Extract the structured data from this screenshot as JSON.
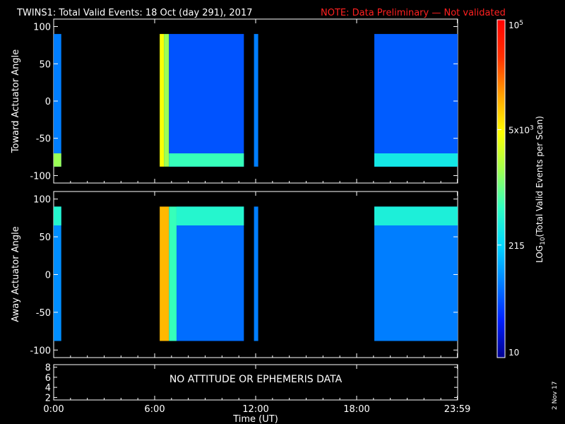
{
  "header": {
    "title": "TWINS1: Total Valid Events: 18 Oct (day 291), 2017",
    "note": "NOTE: Data Preliminary — Not validated",
    "note_color": "#ff2020"
  },
  "footer": {
    "date_stamp": "2 Nov 17",
    "no_data_message": "NO ATTITUDE OR EPHEMERIS DATA"
  },
  "chart_data": [
    {
      "type": "heatmap",
      "name": "toward",
      "ylabel": "Toward Actuator Angle",
      "ylim": [
        -110,
        110
      ],
      "yticks": [
        100,
        50,
        0,
        -50,
        -100
      ],
      "xlim_hours": [
        0,
        24
      ],
      "data_angle_range": [
        -88,
        90
      ],
      "blocks": [
        {
          "start_h": 0.0,
          "end_h": 0.45,
          "level": 0.22,
          "low_edge_level": 0.55
        },
        {
          "start_h": 6.3,
          "end_h": 6.55,
          "level": 0.66
        },
        {
          "start_h": 6.55,
          "end_h": 6.85,
          "level": 0.55
        },
        {
          "start_h": 6.85,
          "end_h": 11.3,
          "level": 0.17,
          "low_edge_level": 0.45
        },
        {
          "start_h": 11.9,
          "end_h": 12.15,
          "level": 0.22
        },
        {
          "start_h": 19.05,
          "end_h": 24.0,
          "level": 0.18,
          "low_edge_level": 0.38
        }
      ]
    },
    {
      "type": "heatmap",
      "name": "away",
      "ylabel": "Away Actuator Angle",
      "ylim": [
        -110,
        110
      ],
      "yticks": [
        100,
        50,
        0,
        -50,
        -100
      ],
      "xlim_hours": [
        0,
        24
      ],
      "data_angle_range": [
        -88,
        90
      ],
      "blocks": [
        {
          "start_h": 0.0,
          "end_h": 0.45,
          "level": 0.24,
          "high_edge_level": 0.42
        },
        {
          "start_h": 6.3,
          "end_h": 6.85,
          "level": 0.75
        },
        {
          "start_h": 6.85,
          "end_h": 7.3,
          "level": 0.45
        },
        {
          "start_h": 7.3,
          "end_h": 11.3,
          "level": 0.2,
          "high_edge_level": 0.42
        },
        {
          "start_h": 11.9,
          "end_h": 12.15,
          "level": 0.22
        },
        {
          "start_h": 19.05,
          "end_h": 24.0,
          "level": 0.22,
          "high_edge_level": 0.4
        }
      ]
    },
    {
      "type": "line",
      "name": "attitude",
      "yticks": [
        8,
        6,
        4,
        2
      ],
      "ylim": [
        1.5,
        8.5
      ],
      "xlim_hours": [
        0,
        24
      ],
      "series": []
    }
  ],
  "x_axis": {
    "label": "Time (UT)",
    "ticks": [
      {
        "hour": 0,
        "label": "0:00"
      },
      {
        "hour": 6,
        "label": "6:00"
      },
      {
        "hour": 12,
        "label": "12:00"
      },
      {
        "hour": 18,
        "label": "18:00"
      },
      {
        "hour": 23.98,
        "label": "23:59"
      }
    ]
  },
  "colorbar": {
    "label": "LOG10(Total Valid Events per Scan)",
    "label_main": "LOG",
    "label_sub": "10",
    "label_rest": "(Total Valid Events per Scan)",
    "scale": "log",
    "range": [
      10,
      100000
    ],
    "ticks": [
      {
        "value": 100000,
        "label": "10",
        "sup": "5"
      },
      {
        "value": 5000,
        "label": "5x10",
        "sup": "3"
      },
      {
        "value": 215,
        "label": "215",
        "sup": ""
      },
      {
        "value": 10,
        "label": "10",
        "sup": ""
      }
    ],
    "stops": [
      "#00008f",
      "#0020ff",
      "#0080ff",
      "#00d8ff",
      "#30ffc0",
      "#a0ff50",
      "#ffff00",
      "#ffa000",
      "#ff3000",
      "#ff0000"
    ]
  }
}
